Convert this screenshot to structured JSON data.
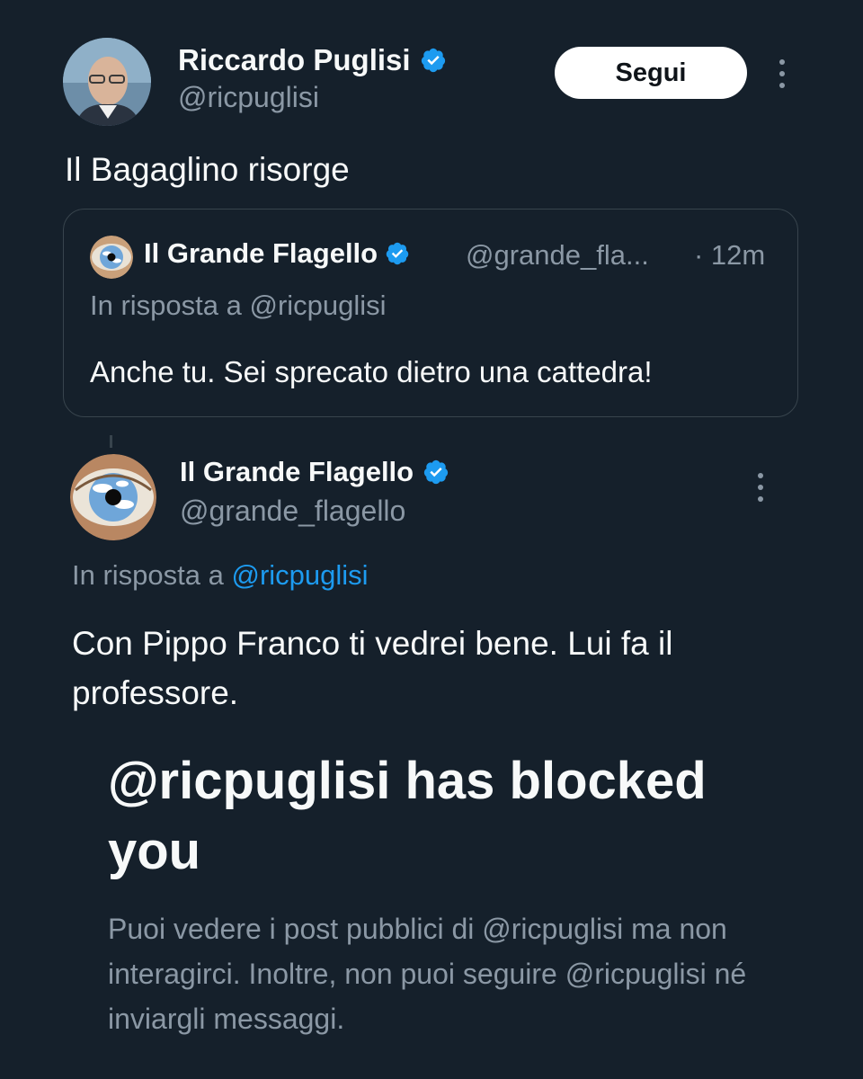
{
  "top_tweet": {
    "author_name": "Riccardo Puglisi",
    "author_handle": "@ricpuglisi",
    "follow_label": "Segui",
    "text": "Il Bagaglino risorge"
  },
  "quoted_tweet": {
    "author_name": "Il Grande Flagello",
    "author_handle": "@grande_fla...",
    "time": "· 12m",
    "reply_to": "In risposta a @ricpuglisi",
    "text": "Anche tu. Sei sprecato dietro una cattedra!"
  },
  "reply_tweet": {
    "author_name": "Il Grande Flagello",
    "author_handle": "@grande_flagello",
    "reply_prefix": "In risposta a",
    "reply_mention": "@ricpuglisi",
    "text": "Con Pippo Franco ti vedrei bene. Lui fa il professore."
  },
  "blocked_notice": {
    "title": "@ricpuglisi has blocked you",
    "description": "Puoi vedere i post pubblici di @ricpuglisi ma non interagirci. Inoltre, non puoi seguire @ricpuglisi né inviargli messaggi."
  },
  "colors": {
    "background": "#15202b",
    "primary_text": "#f7f9f9",
    "secondary_text": "#8b98a5",
    "accent": "#1d9bf0",
    "border": "#38444d"
  },
  "icons": [
    "verified-badge-icon",
    "more-options-icon"
  ]
}
